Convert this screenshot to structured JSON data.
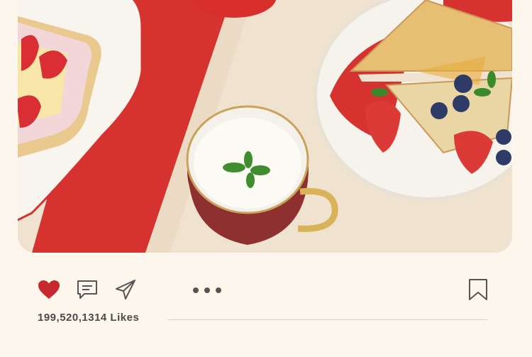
{
  "post": {
    "image_icon": "breakfast-photo",
    "likes_text": "199,520,1314 Likes"
  },
  "actions": {
    "like_icon": "heart-icon",
    "comment_icon": "comment-icon",
    "share_icon": "send-icon",
    "more_icon": "more-dots-icon",
    "save_icon": "bookmark-icon"
  },
  "colors": {
    "background": "#fdf6ec",
    "heart": "#c8292e",
    "icon_stroke": "#555555",
    "text": "#4a4a4a"
  }
}
